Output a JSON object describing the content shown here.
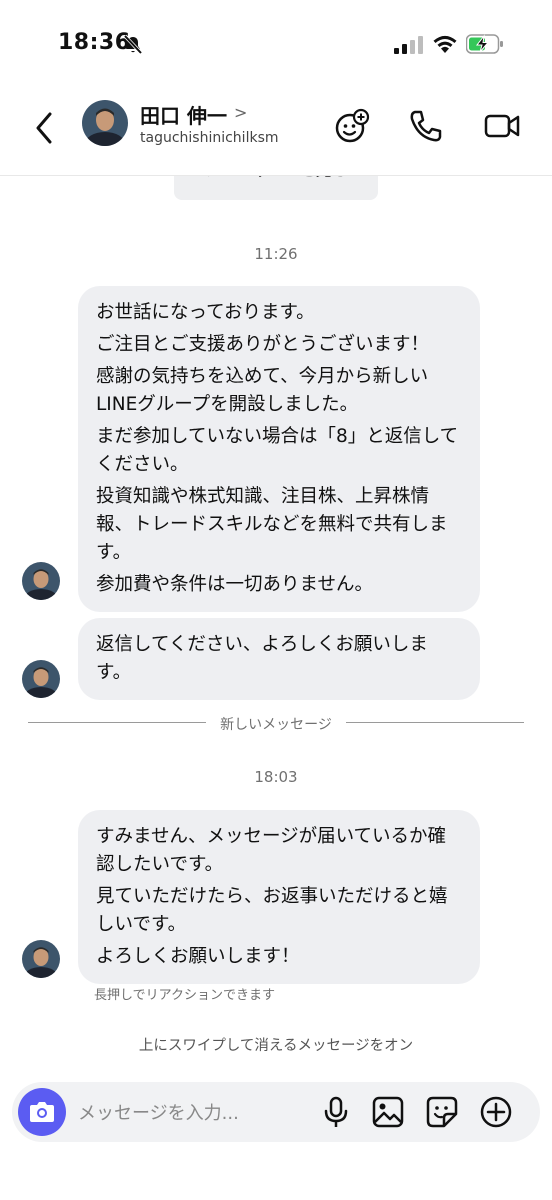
{
  "status_bar": {
    "time": "18:36"
  },
  "header": {
    "name": "田口 伸一",
    "chevron": ">",
    "username": "taguchishinichilksm"
  },
  "profile_button": {
    "label": "プロフィールを見る"
  },
  "messages": [
    {
      "time": "11:26",
      "lines": [
        "お世話になっております。",
        "ご注目とご支援ありがとうございます！",
        "感謝の気持ちを込めて、今月から新しいLINEグループを開設しました。",
        "まだ参加していない場合は「8」と返信してください。",
        "投資知識や株式知識、注目株、上昇株情報、トレードスキルなどを無料で共有します。",
        "参加費や条件は一切ありません。"
      ]
    },
    {
      "lines": [
        "返信してください、よろしくお願いします。"
      ]
    }
  ],
  "new_messages_divider": "新しいメッセージ",
  "second_time": "18:03",
  "last_message": {
    "lines": [
      "すみません、メッセージが届いているか確認したいです。",
      "見ていただけたら、お返事いただけると嬉しいです。",
      "よろしくお願いします！"
    ]
  },
  "hint": "長押しでリアクションできます",
  "swipe_hint": "上にスワイプして消えるメッセージをオン",
  "composer": {
    "placeholder": "メッセージを入力..."
  },
  "colors": {
    "accent": "#5b5cf2",
    "bubble": "#eeeff2",
    "battery_green": "#34c759"
  },
  "icons": [
    "bell-slash-icon",
    "signal-icon",
    "wifi-icon",
    "battery-charging-icon",
    "back-arrow-icon",
    "effects-icon",
    "phone-icon",
    "video-icon",
    "camera-icon",
    "microphone-icon",
    "image-icon",
    "sticker-icon",
    "plus-circle-icon"
  ]
}
